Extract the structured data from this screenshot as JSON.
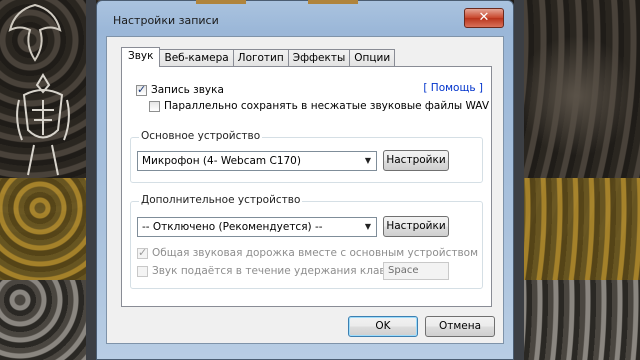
{
  "window": {
    "title": "Настройки записи",
    "close_glyph": "✕"
  },
  "tabs": [
    {
      "label": "Звук",
      "active": true
    },
    {
      "label": "Веб-камера",
      "active": false
    },
    {
      "label": "Логотип",
      "active": false
    },
    {
      "label": "Эффекты",
      "active": false
    },
    {
      "label": "Опции",
      "active": false
    }
  ],
  "sound": {
    "help_link": "[ Помощь ]",
    "record_sound": {
      "label": "Запись звука",
      "checked": true
    },
    "save_wav": {
      "label": "Параллельно сохранять в несжатые звуковые файлы WAV",
      "checked": false
    },
    "primary_device": {
      "group_label": "Основное устройство",
      "selected": "Микрофон (4- Webcam C170)",
      "settings_label": "Настройки"
    },
    "secondary_device": {
      "group_label": "Дополнительное устройство",
      "selected": "-- Отключено (Рекомендуется) --",
      "settings_label": "Настройки",
      "common_track": {
        "label": "Общая звуковая дорожка вместе с основным устройством",
        "checked": true,
        "disabled": true
      },
      "hold_key": {
        "label": "Звук подаётся в течение удержания клавиши",
        "checked": false,
        "disabled": true
      },
      "hold_key_value": "Space"
    }
  },
  "footer": {
    "ok_label": "OK",
    "cancel_label": "Отмена"
  }
}
